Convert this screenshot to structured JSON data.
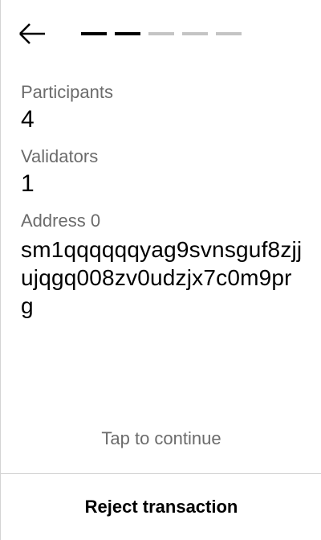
{
  "header": {
    "back_icon": "arrow-left-icon",
    "steps": [
      {
        "state": "done"
      },
      {
        "state": "done"
      },
      {
        "state": "pending"
      },
      {
        "state": "pending"
      },
      {
        "state": "pending"
      }
    ]
  },
  "fields": {
    "participants_label": "Participants",
    "participants_value": "4",
    "validators_label": "Validators",
    "validators_value": "1",
    "address_label": "Address 0",
    "address_value": "sm1qqqqqqyag9svnsguf8zjjujqgq008zv0udzjx7c0m9prg"
  },
  "footer": {
    "tap_continue": "Tap to continue",
    "reject_label": "Reject transaction"
  },
  "colors": {
    "text_primary": "#000000",
    "text_secondary": "#6b6b6b",
    "step_done": "#000000",
    "step_pending": "#c4c4c4",
    "divider": "#cfcfcf"
  }
}
